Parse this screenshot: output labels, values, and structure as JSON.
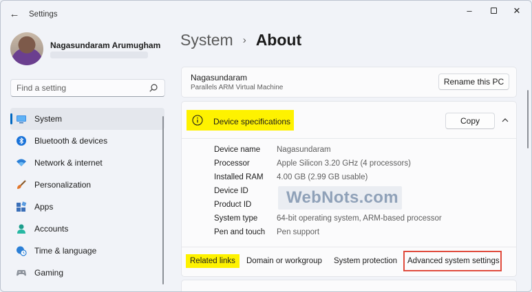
{
  "window": {
    "title": "Settings",
    "back_icon": "arrow-left-icon",
    "controls": [
      "minimize",
      "maximize",
      "close"
    ]
  },
  "profile": {
    "name": "Nagasundaram Arumugham"
  },
  "search": {
    "placeholder": "Find a setting"
  },
  "sidebar": {
    "items": [
      {
        "label": "System",
        "icon": "monitor-icon",
        "active": true
      },
      {
        "label": "Bluetooth & devices",
        "icon": "bluetooth-icon",
        "active": false
      },
      {
        "label": "Network & internet",
        "icon": "wifi-icon",
        "active": false
      },
      {
        "label": "Personalization",
        "icon": "brush-icon",
        "active": false
      },
      {
        "label": "Apps",
        "icon": "apps-icon",
        "active": false
      },
      {
        "label": "Accounts",
        "icon": "person-icon",
        "active": false
      },
      {
        "label": "Time & language",
        "icon": "clock-globe-icon",
        "active": false
      },
      {
        "label": "Gaming",
        "icon": "gamepad-icon",
        "active": false
      }
    ]
  },
  "breadcrumb": {
    "parent": "System",
    "separator": "›",
    "current": "About"
  },
  "pc_card": {
    "name": "Nagasundaram",
    "model": "Parallels ARM Virtual Machine",
    "rename_label": "Rename this PC"
  },
  "device_specs": {
    "title": "Device specifications",
    "copy_label": "Copy",
    "rows": [
      {
        "label": "Device name",
        "value": "Nagasundaram"
      },
      {
        "label": "Processor",
        "value": "Apple Silicon   3.20 GHz  (4 processors)"
      },
      {
        "label": "Installed RAM",
        "value": "4.00 GB (2.99 GB usable)"
      },
      {
        "label": "Device ID",
        "value": ""
      },
      {
        "label": "Product ID",
        "value": ""
      },
      {
        "label": "System type",
        "value": "64-bit operating system, ARM-based processor"
      },
      {
        "label": "Pen and touch",
        "value": "Pen support"
      }
    ],
    "watermark": "WebNots.com"
  },
  "related_links": {
    "label": "Related links",
    "links": [
      "Domain or workgroup",
      "System protection",
      "Advanced system settings"
    ]
  },
  "colors": {
    "accent": "#0067c0",
    "highlight": "#fef200",
    "annotation_box": "#e04a3c"
  }
}
